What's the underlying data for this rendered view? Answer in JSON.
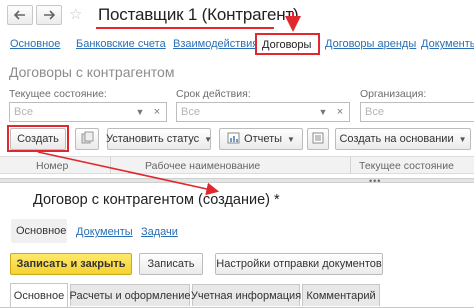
{
  "window": {
    "title": "Поставщик 1 (Контрагент)",
    "back_icon": "arrow-left-icon",
    "forward_icon": "arrow-right-icon",
    "favorite_icon": "star-icon"
  },
  "nav_links": [
    {
      "label": "Основное"
    },
    {
      "label": "Банковские счета"
    },
    {
      "label": "Взаимодействия"
    },
    {
      "label": "Договоры"
    },
    {
      "label": "Договоры аренды"
    },
    {
      "label": "Документы"
    }
  ],
  "list": {
    "heading": "Договоры с контрагентом",
    "filters": [
      {
        "label": "Текущее состояние:",
        "placeholder": "Все"
      },
      {
        "label": "Срок действия:",
        "placeholder": "Все"
      },
      {
        "label": "Организация:",
        "placeholder": "Все"
      }
    ],
    "toolbar": {
      "create": "Создать",
      "set_status": "Установить статус",
      "reports": "Отчеты",
      "create_based_on": "Создать на основании"
    },
    "columns": [
      "Номер",
      "Рабочее наименование",
      "Текущее состояние"
    ]
  },
  "form": {
    "title": "Договор с контрагентом (создание) *",
    "nav": {
      "main": "Основное",
      "documents": "Документы",
      "tasks": "Задачи"
    },
    "buttons": {
      "save_close": "Записать и закрыть",
      "save": "Записать",
      "doc_settings": "Настройки отправки документов"
    },
    "page_tabs": [
      {
        "label": "Основное"
      },
      {
        "label": "Расчеты и оформление"
      },
      {
        "label": "Учетная информация"
      },
      {
        "label": "Комментарий"
      }
    ]
  },
  "colors": {
    "accent_red": "#e0282e",
    "link_blue": "#2a6fb5",
    "primary_yellow": "#f4d231"
  }
}
